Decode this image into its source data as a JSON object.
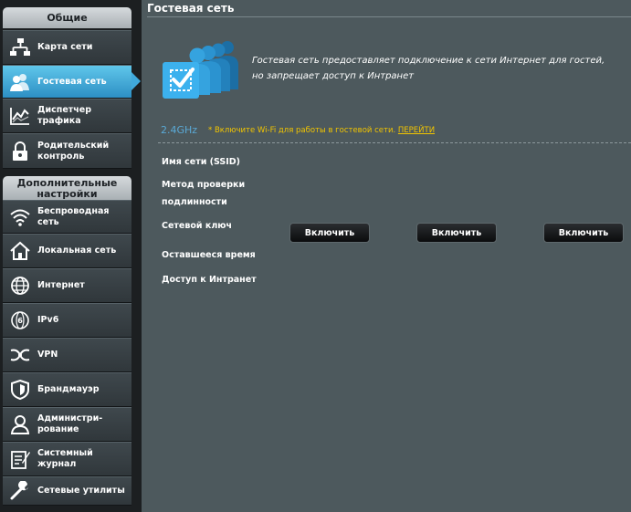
{
  "sidebar": {
    "general_header": "Общие",
    "general_items": [
      {
        "label": "Карта сети",
        "icon": "network-map-icon"
      },
      {
        "label": "Гостевая сеть",
        "icon": "guest-network-icon",
        "active": true
      },
      {
        "label": "Диспетчер\nтрафика",
        "icon": "traffic-manager-icon"
      },
      {
        "label": "Родительский\nконтроль",
        "icon": "parental-control-icon"
      }
    ],
    "advanced_header": "Дополнительные\nнастройки",
    "advanced_items": [
      {
        "label": "Беспроводная\nсеть",
        "icon": "wireless-icon"
      },
      {
        "label": "Локальная сеть",
        "icon": "lan-icon"
      },
      {
        "label": "Интернет",
        "icon": "internet-icon"
      },
      {
        "label": "IPv6",
        "icon": "ipv6-icon"
      },
      {
        "label": "VPN",
        "icon": "vpn-icon"
      },
      {
        "label": "Брандмауэр",
        "icon": "firewall-icon"
      },
      {
        "label": "Администри-\nрование",
        "icon": "administration-icon"
      },
      {
        "label": "Системный\nжурнал",
        "icon": "system-log-icon"
      },
      {
        "label": "Сетевые утилиты",
        "icon": "network-tools-icon"
      }
    ]
  },
  "main": {
    "title": "Гостевая сеть",
    "description": "Гостевая сеть предоставляет подключение к сети Интернет для гостей, но запрещает доступ к Интранет",
    "band": "2.4GHz",
    "band_note": "* Включите Wi-Fi для работы в гостевой сети.",
    "band_link": "ПЕРЕЙТИ",
    "rows": {
      "ssid": "Имя сети (SSID)",
      "auth": "Метод проверки\nподлинности",
      "key": "Сетевой ключ",
      "time_left": "Оставшееся время",
      "intranet": "Доступ к Интранет"
    },
    "enable_buttons": [
      "Включить",
      "Включить",
      "Включить"
    ]
  },
  "colors": {
    "accent": "#40a9db",
    "panel": "#4d595d",
    "warning": "#f2c500",
    "band": "#5aa9d6"
  }
}
